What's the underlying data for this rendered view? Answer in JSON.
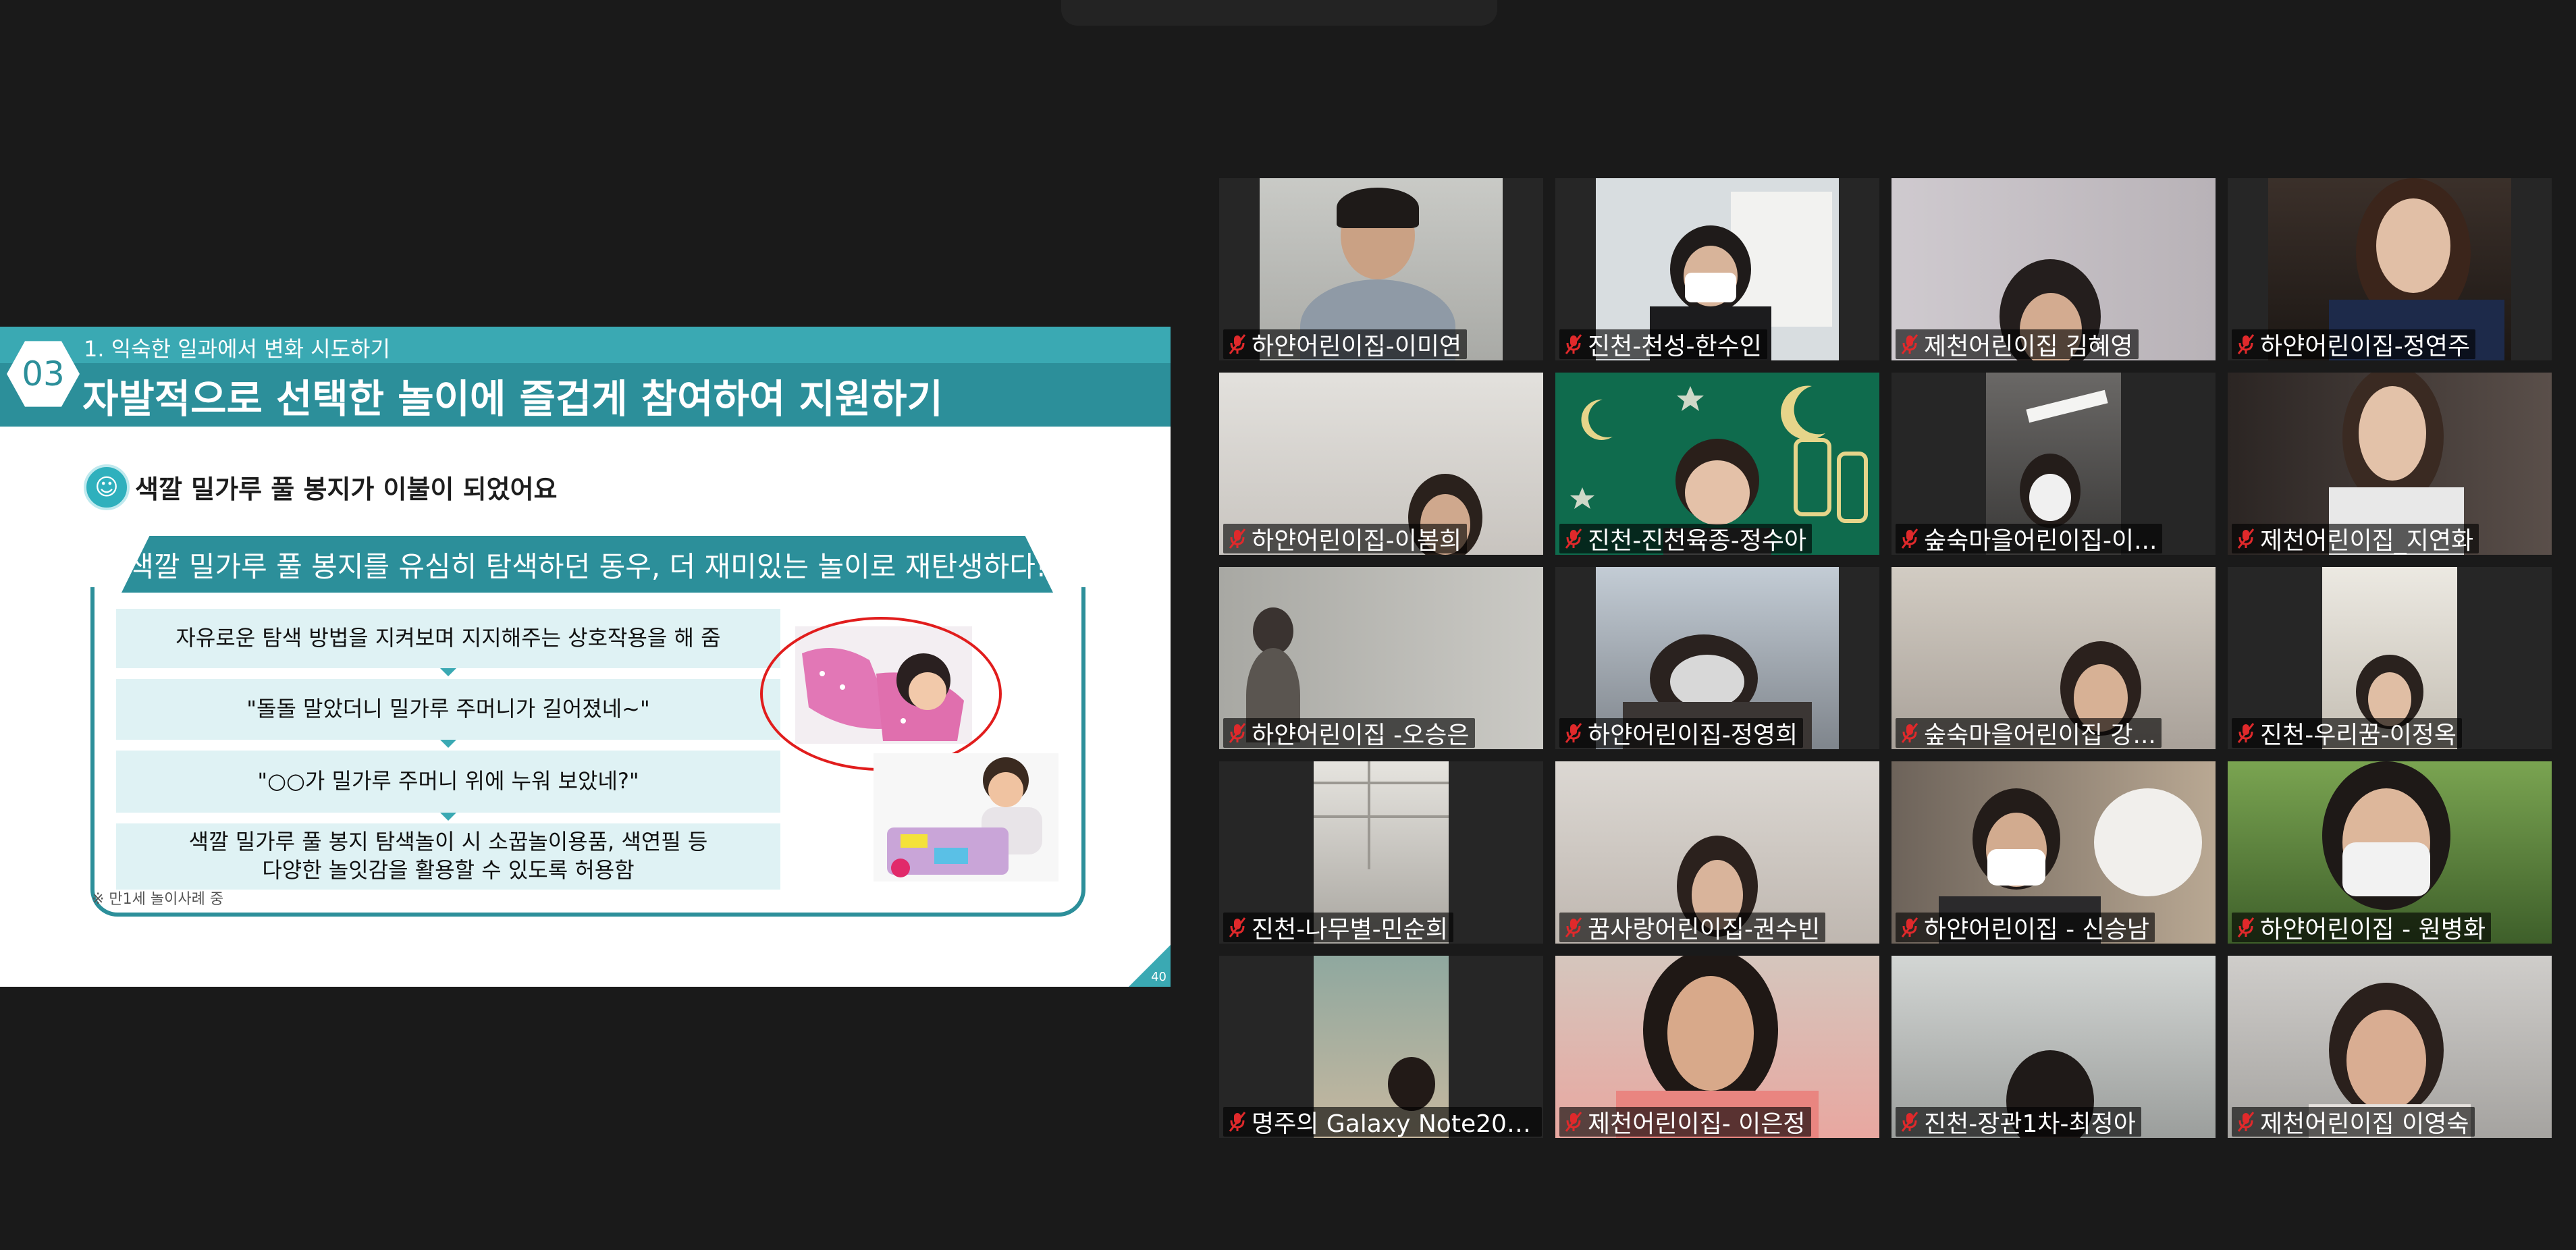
{
  "slide": {
    "badge": "03",
    "section": "1. 익숙한 일과에서 변화 시도하기",
    "title": "자발적으로 선택한 놀이에 즐겁게 참여하여 지원하기",
    "subheading": "색깔 밀가루 풀 봉지가 이불이 되었어요",
    "banner": "색깔 밀가루 풀 봉지를 유심히 탐색하던 동우, 더 재미있는 놀이로 재탄생하다!",
    "steps": [
      "자유로운 탐색 방법을 지켜보며 지지해주는 상호작용을 해 줌",
      "\"돌돌 말았더니 밀가루 주머니가 길어졌네~\"",
      "\"○○가 밀가루 주머니 위에 누워 보았네?\"",
      "색깔 밀가루 풀 봉지 탐색놀이 시 소꿉놀이용품, 색연필 등\n다양한 놀잇감을 활용할 수 있도록 허용함"
    ],
    "footnote": "※ 만1세 놀이사례 중",
    "page_number": "40"
  },
  "participants": [
    {
      "name": "하얀어린이집-이미연",
      "muted": true
    },
    {
      "name": "진천-천성-한수인",
      "muted": true
    },
    {
      "name": "제천어린이집 김혜영",
      "muted": true
    },
    {
      "name": "하얀어린이집-정연주",
      "muted": true
    },
    {
      "name": "하얀어린이집-이봄희",
      "muted": true
    },
    {
      "name": "진천-진천육종-정수아",
      "muted": true
    },
    {
      "name": "숲숙마을어린이집-이...",
      "muted": true
    },
    {
      "name": "제천어린이집_지연화",
      "muted": true
    },
    {
      "name": "하얀어린이집 -오승은",
      "muted": true
    },
    {
      "name": "하얀어린이집-정영희",
      "muted": true
    },
    {
      "name": "숲숙마을어린이집 강...",
      "muted": true
    },
    {
      "name": "진천-우리꿈-이정옥",
      "muted": true
    },
    {
      "name": "진천-나무별-민순희",
      "muted": true
    },
    {
      "name": "꿈사랑어린이집-권수빈",
      "muted": true
    },
    {
      "name": "하얀어린이집 - 신승남",
      "muted": true
    },
    {
      "name": "하얀어린이집 - 원병화",
      "muted": true
    },
    {
      "name": "명주의 Galaxy Note20 ...",
      "muted": true
    },
    {
      "name": "제천어린이집- 이은정",
      "muted": true
    },
    {
      "name": "진천-장관1차-최정아",
      "muted": true
    },
    {
      "name": "제천어린이집 이영숙",
      "muted": true
    }
  ],
  "icons": {
    "muted_mic": "muted-microphone-icon",
    "smiley": "smiley-icon"
  },
  "colors": {
    "teal": "#2c8f9a",
    "teal_light": "#3aa9b3",
    "step_bg": "#dff2f4",
    "mute_red": "#e0292b",
    "circle_red": "#e11d1d"
  }
}
